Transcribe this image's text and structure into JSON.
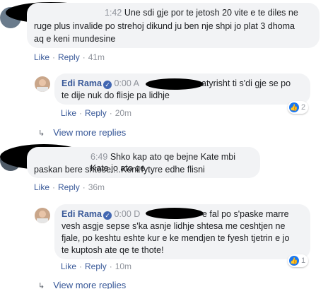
{
  "comments": [
    {
      "timestamp": "1:42",
      "text_line1": "Une sdi gje por te jetosh 20 vite e te diles ne",
      "text_line2": "ruge plus invalide po strehoj dikund ju ben nje shpi jo plat 3 dhoma",
      "text_line3": "aq e keni mundesine",
      "like": "Like",
      "reply": "Reply",
      "age": "41m"
    },
    {
      "timestamp": "6:49",
      "text_line1": "Shko kap ato qe bejne Kate mbi Kate jo ato qe",
      "text_line2": "paskan bere shtese....Keni fytyre edhe flisni",
      "like": "Like",
      "reply": "Reply",
      "age": "36m"
    }
  ],
  "replies": [
    {
      "author": "Edi Rama",
      "timestamp": "0:00",
      "ts_suffix": "A",
      "text_line1": "atyrisht ti s'di gje se po",
      "text_line2": "te dije nuk do flisje pa lidhje",
      "like": "Like",
      "reply": "Reply",
      "age": "20m",
      "reaction_count": "2"
    },
    {
      "author": "Edi Rama",
      "timestamp": "0:00",
      "ts_suffix": "D",
      "text_line1": "e fal po s'paske marre",
      "text_line2": "vesh asgje sepse s'ka asnje lidhje shtesa me ceshtjen ne",
      "text_line3": "fjale, po keshtu eshte kur e ke mendjen te fyesh tjetrin e jo",
      "text_line4": "te kuptosh ate qe te thote!",
      "like": "Like",
      "reply": "Reply",
      "age": "10m",
      "reaction_count": "1"
    }
  ],
  "view_more": [
    "View more replies",
    "View more replies"
  ],
  "separator": "·",
  "colors": {
    "link": "#385898",
    "bubble": "#f2f3f5",
    "meta": "#90949c",
    "like": "#1877f2"
  }
}
